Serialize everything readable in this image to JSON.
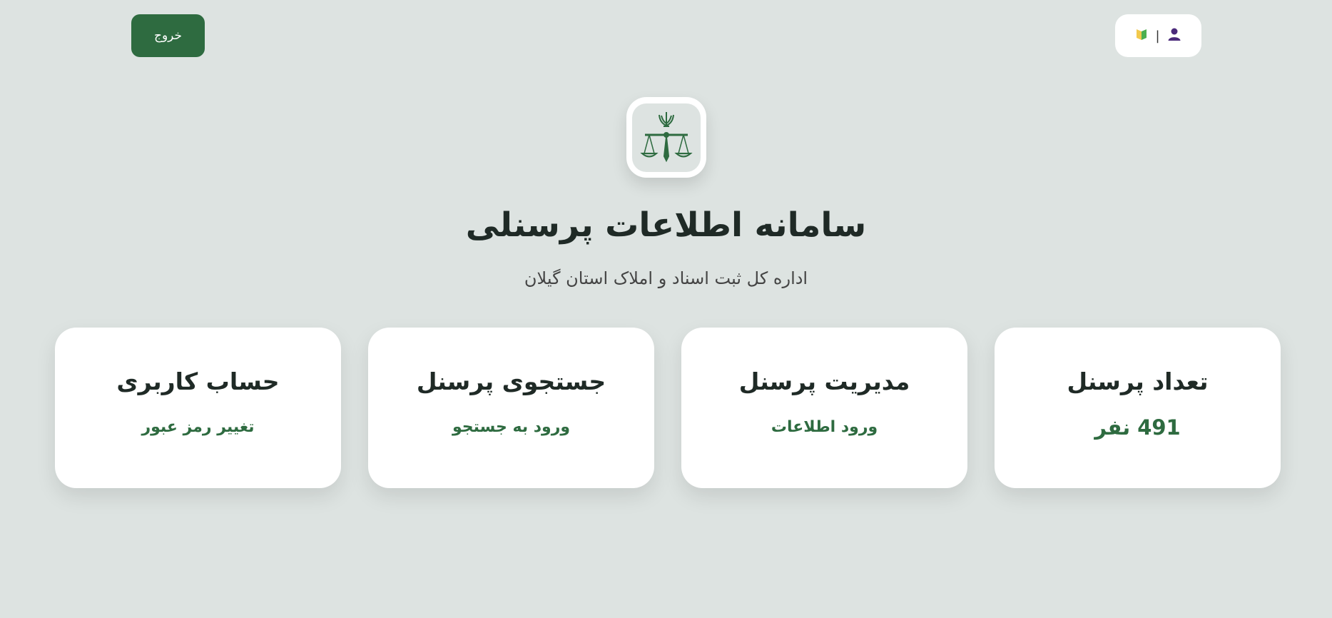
{
  "header": {
    "logout_label": "خروج",
    "user_pill": {
      "user_icon": "user-icon",
      "separator": "|",
      "badge_icon": "leaf-badge-icon"
    }
  },
  "emblem": {
    "icon": "scales-of-justice-emblem-icon"
  },
  "title": "سامانه اطلاعات پرسنلی",
  "subtitle": "اداره کل ثبت اسناد و املاک استان گیلان",
  "cards": [
    {
      "title": "تعداد پرسنل",
      "value": "491 نفر"
    },
    {
      "title": "مدیریت پرسنل",
      "link": "ورود اطلاعات"
    },
    {
      "title": "جستجوی پرسنل",
      "link": "ورود به جستجو"
    },
    {
      "title": "حساب کاربری",
      "link": "تغییر رمز عبور"
    }
  ],
  "colors": {
    "accent": "#2e6b40",
    "background": "#dde3e1",
    "card": "#ffffff"
  }
}
